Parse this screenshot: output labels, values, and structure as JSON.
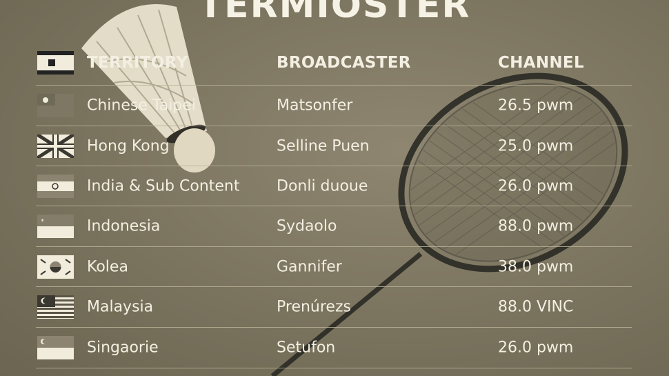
{
  "title": "TERMIOSTER",
  "headers": {
    "territory": "TERRITORY",
    "broadcaster": "BROADCASTER",
    "channel": "CHANNEL"
  },
  "rows": [
    {
      "territory": "Chinese Taipei",
      "broadcaster": "Matsonfer",
      "channel": "26.5 pwm",
      "flag_icon": "taiwan-flag-icon"
    },
    {
      "territory": "Hong Kong",
      "broadcaster": "Selline Puen",
      "channel": "25.0 pwm",
      "flag_icon": "union-jack-flag-icon"
    },
    {
      "territory": "India & Sub Content",
      "broadcaster": "Donli duoue",
      "channel": "26.0 pwm",
      "flag_icon": "india-flag-icon"
    },
    {
      "territory": "Indonesia",
      "broadcaster": "Sydaolo",
      "channel": "88.0 pwm",
      "flag_icon": "indonesia-flag-icon"
    },
    {
      "territory": "Kolea",
      "broadcaster": "Gannifer",
      "channel": "38.0 pwm",
      "flag_icon": "korea-flag-icon"
    },
    {
      "territory": "Malaysia",
      "broadcaster": "Prenúrezs",
      "channel": "88.0 VINC",
      "flag_icon": "malaysia-flag-icon"
    },
    {
      "territory": "Singaorie",
      "broadcaster": "Setufon",
      "channel": "26.0 pwm",
      "flag_icon": "singapore-flag-icon"
    }
  ]
}
